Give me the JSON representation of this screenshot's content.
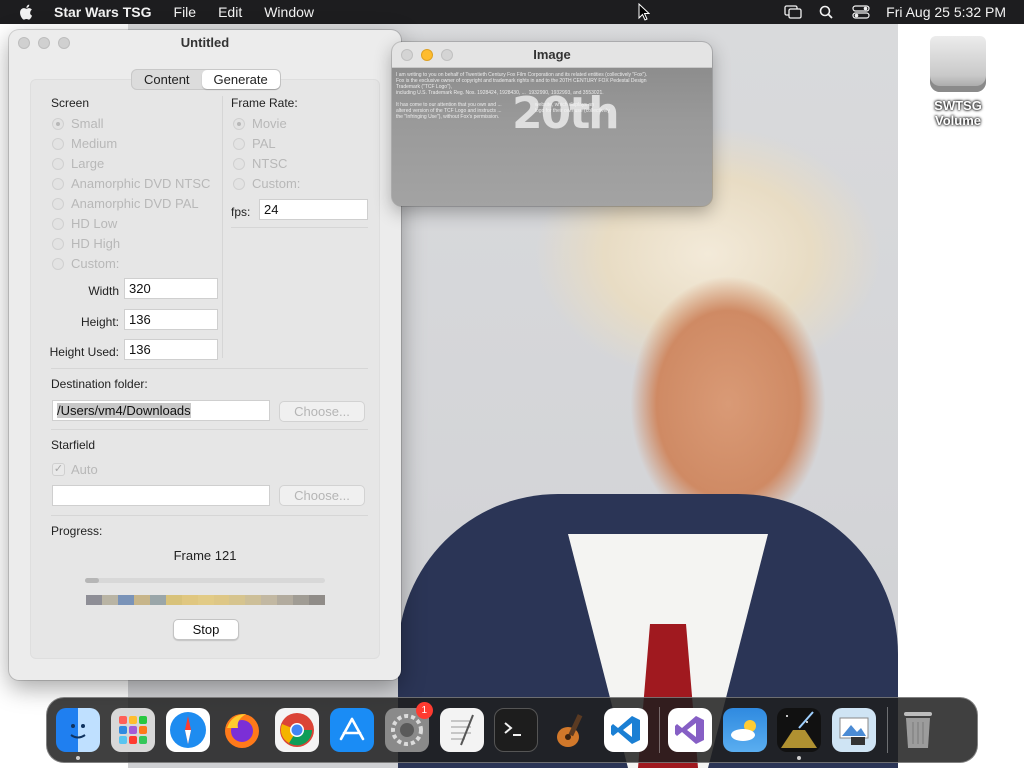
{
  "menubar": {
    "app_name": "Star Wars TSG",
    "menus": [
      "File",
      "Edit",
      "Window"
    ],
    "clock": "Fri Aug 25  5:32 PM"
  },
  "desktop": {
    "volume_label": "SWTSG Volume"
  },
  "main_window": {
    "title": "Untitled",
    "tabs": [
      {
        "label": "Content",
        "active": false
      },
      {
        "label": "Generate",
        "active": true
      }
    ],
    "screen": {
      "label": "Screen",
      "options": [
        "Small",
        "Medium",
        "Large",
        "Anamorphic DVD NTSC",
        "Anamorphic DVD PAL",
        "HD Low",
        "HD High",
        "Custom:"
      ],
      "selected": "Small"
    },
    "frame_rate": {
      "label": "Frame Rate:",
      "options": [
        "Movie",
        "PAL",
        "NTSC",
        "Custom:"
      ],
      "selected": "Movie",
      "fps_label": "fps:",
      "fps_value": "24"
    },
    "dimensions": {
      "width_label": "Width",
      "width_value": "320",
      "height_label": "Height:",
      "height_value": "136",
      "height_used_label": "Height Used:",
      "height_used_value": "136"
    },
    "destination": {
      "label": "Destination folder:",
      "path": "/Users/vm4/Downloads",
      "choose_label": "Choose..."
    },
    "starfield": {
      "label": "Starfield",
      "auto_label": "Auto",
      "auto_checked": true,
      "path": "",
      "choose_label": "Choose..."
    },
    "progress": {
      "label": "Progress:",
      "status": "Frame 121",
      "fraction": 0.06,
      "stop_label": "Stop"
    }
  },
  "image_window": {
    "title": "Image",
    "letter_text": "I am writing to you on behalf of Twentieth Century Fox Film Corporation and its related entities (collectively \"Fox\").\nFox is the exclusive owner of copyright and trademark rights in and to the 20TH CENTURY FOX Pedestal Design\nTrademark (\"TCF Logo\"),\nincluding U.S. Trademark Reg. Nos. 1928424, 1928430, ...  1932990, 1932993, and 3553021.\n\nIt has come to our attention that you own and ...                        website, which displays an\naltered version of the TCF Logo and instructs ...                        logo for their own use (collectively\nthe \"Infringing Use\"), without Fox's permission.",
    "logo_text": "20th"
  },
  "dock": {
    "items": [
      {
        "name": "finder-icon",
        "color": "#3d8ef5",
        "running": true
      },
      {
        "name": "launchpad-icon",
        "color": "#c9c9c9",
        "running": false
      },
      {
        "name": "safari-icon",
        "color": "#1e8cf0",
        "running": false
      },
      {
        "name": "firefox-icon",
        "color": "#ff7a1a",
        "running": false
      },
      {
        "name": "chrome-icon",
        "color": "#f4f4f4",
        "running": false
      },
      {
        "name": "app-store-icon",
        "color": "#1a8cf5",
        "running": false
      },
      {
        "name": "system-settings-icon",
        "color": "#8a8a8a",
        "running": false,
        "badge": "1"
      },
      {
        "name": "textedit-icon",
        "color": "#f3f3f3",
        "running": false
      },
      {
        "name": "terminal-icon",
        "color": "#1d1d1d",
        "running": false
      },
      {
        "name": "garageband-icon",
        "color": "#5a3a22",
        "running": false
      },
      {
        "name": "vscode-icon",
        "color": "#ffffff",
        "running": false
      },
      {
        "name": "visual-studio-icon",
        "color": "#ffffff",
        "running": false
      },
      {
        "name": "weather-icon",
        "color": "#2f8ae0",
        "running": false
      },
      {
        "name": "star-wars-tsg-icon",
        "color": "#111111",
        "running": true
      },
      {
        "name": "preview-icon",
        "color": "#cfe4f4",
        "running": false
      },
      {
        "name": "trash-icon",
        "color": "#9c9c9c",
        "running": false
      }
    ]
  }
}
